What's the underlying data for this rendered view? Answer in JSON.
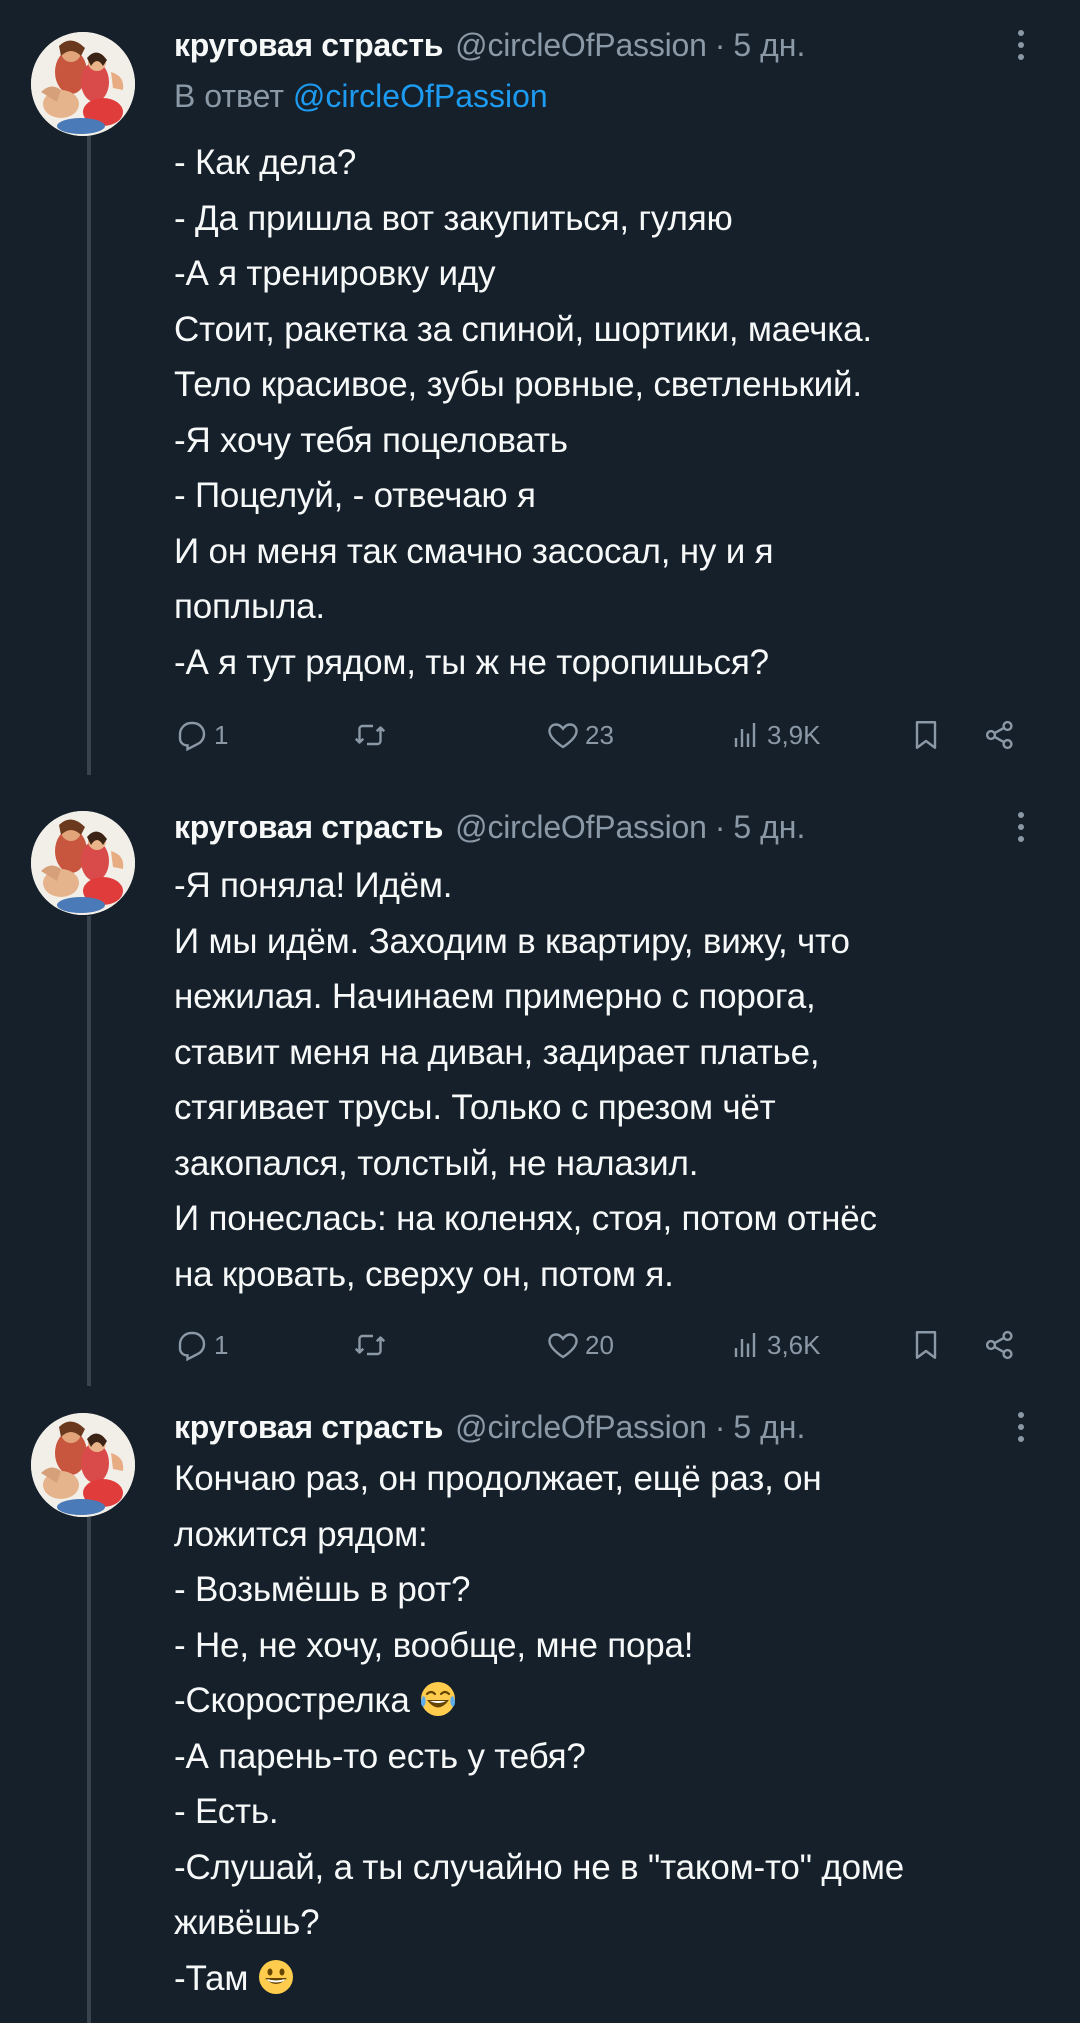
{
  "theme": {
    "background": "#15202b",
    "text": "#f7f9f9",
    "secondary": "#8b98a5",
    "link": "#1d9bf0",
    "thread_line": "#38444d"
  },
  "tweets": [
    {
      "name": "круговая страсть",
      "handle": "@circleOfPassion",
      "separator": "·",
      "time": "5 дн.",
      "reply_prefix": "В ответ",
      "reply_mention": "@circleOfPassion",
      "lines": [
        "- Как дела?",
        "- Да пришла вот закупиться, гуляю",
        "-А я тренировку иду",
        "Стоит, ракетка за спиной, шортики, маечка.",
        "Тело красивое, зубы ровные, светленький.",
        "-Я хочу тебя поцеловать",
        "- Поцелуй, - отвечаю я",
        "И он меня так смачно засосал, ну и я",
        "поплыла.",
        "-А я тут рядом, ты ж не торопишься?"
      ],
      "replies": "1",
      "retweets": "",
      "likes": "23",
      "views": "3,9K"
    },
    {
      "name": "круговая страсть",
      "handle": "@circleOfPassion",
      "separator": "·",
      "time": "5 дн.",
      "lines": [
        "-Я поняла! Идём.",
        "И мы идём. Заходим в квартиру, вижу, что",
        "нежилая. Начинаем примерно с порога,",
        "ставит меня на диван, задирает платье,",
        "стягивает трусы. Только с презом чёт",
        "закопался, толстый, не налазил.",
        "И понеслась: на коленях, стоя, потом отнёс",
        "на кровать, сверху он, потом я."
      ],
      "replies": "1",
      "retweets": "",
      "likes": "20",
      "views": "3,6K"
    },
    {
      "name": "круговая страсть",
      "handle": "@circleOfPassion",
      "separator": "·",
      "time": "5 дн.",
      "lines": [
        "Кончаю раз, он продолжает, ещё раз, он",
        "ложится рядом:",
        "- Возьмёшь в рот?",
        "- Не, не хочу, вообще, мне пора!",
        "-Скорострелка",
        "-А парень-то есть у тебя?",
        "- Есть.",
        "-Слушай, а ты случайно не в \"таком-то\" доме",
        "живёшь?",
        "-Там"
      ],
      "emoji_after": {
        "4": "face-with-tears-of-joy-icon",
        "9": "grinning-face-icon"
      }
    }
  ],
  "icons": {
    "reply": "reply-icon",
    "retweet": "retweet-icon",
    "like": "heart-icon",
    "views": "views-icon",
    "bookmark": "bookmark-icon",
    "share": "share-icon",
    "more": "more-icon"
  }
}
